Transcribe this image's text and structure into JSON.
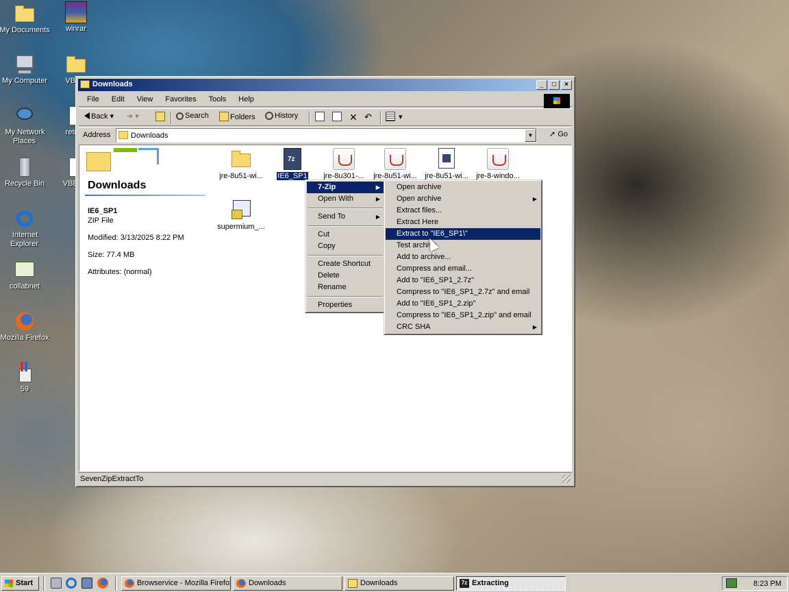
{
  "desktop": {
    "icons": [
      {
        "label": "My Documents",
        "icon": "my-documents-icon"
      },
      {
        "label": "winrar",
        "icon": "winrar-icon"
      },
      {
        "label": "My Computer",
        "icon": "my-computer-icon"
      },
      {
        "label": "VBEM",
        "icon": "folder-icon"
      },
      {
        "label": "My Network Places",
        "icon": "network-places-icon"
      },
      {
        "label": "retrozi",
        "icon": "file-icon"
      },
      {
        "label": "Recycle Bin",
        "icon": "recycle-bin-icon"
      },
      {
        "label": "VBEMP",
        "icon": "file-icon"
      },
      {
        "label": "Internet Explorer",
        "icon": "internet-explorer-icon"
      },
      {
        "label": "collabnet",
        "icon": "collabnet-icon"
      },
      {
        "label": "Mozilla Firefox",
        "icon": "firefox-icon"
      },
      {
        "label": "59",
        "icon": "paint-icon"
      }
    ]
  },
  "window": {
    "title": "Downloads",
    "menu": [
      "File",
      "Edit",
      "View",
      "Favorites",
      "Tools",
      "Help"
    ],
    "toolbar": {
      "back": "Back",
      "search": "Search",
      "folders": "Folders",
      "history": "History"
    },
    "address": {
      "label": "Address",
      "value": "Downloads",
      "go": "Go"
    },
    "left_pane": {
      "title": "Downloads",
      "name": "IE6_SP1",
      "type": "ZIP File",
      "modified": "Modified: 3/13/2025 8:22 PM",
      "size": "Size: 77.4 MB",
      "attributes": "Attributes: (normal)"
    },
    "files": [
      {
        "label": "jre-8u51-wi...",
        "icon": "folder-icon"
      },
      {
        "label": "IE6_SP1",
        "icon": "7zip-archive-icon",
        "selected": true
      },
      {
        "label": "jre-8u301-...",
        "icon": "java-icon"
      },
      {
        "label": "jre-8u51-wi...",
        "icon": "java-icon"
      },
      {
        "label": "jre-8u51-wi...",
        "icon": "7zip-file-icon"
      },
      {
        "label": "jre-8-windo...",
        "icon": "java-icon"
      },
      {
        "label": "supermium_...",
        "icon": "installer-icon"
      }
    ],
    "status": "SevenZipExtractTo"
  },
  "context_menu": {
    "items": [
      "7-Zip",
      "Open With",
      "Send To",
      "Cut",
      "Copy",
      "Create Shortcut",
      "Delete",
      "Rename",
      "Properties"
    ]
  },
  "submenu": {
    "items": [
      "Open archive",
      "Open archive",
      "Extract files...",
      "Extract Here",
      "Extract to \"IE6_SP1\\\"",
      "Test archive",
      "Add to archive...",
      "Compress and email...",
      "Add to \"IE6_SP1_2.7z\"",
      "Compress to \"IE6_SP1_2.7z\" and email",
      "Add to \"IE6_SP1_2.zip\"",
      "Compress to \"IE6_SP1_2.zip\" and email",
      "CRC SHA"
    ],
    "highlighted": "Extract to \"IE6_SP1\\\""
  },
  "taskbar": {
    "start": "Start",
    "tasks": [
      "Browservice - Mozilla Firefox",
      "Downloads",
      "Downloads",
      "Extracting"
    ],
    "clock": "8:23 PM"
  },
  "colors": {
    "highlight": "#0a246a",
    "face": "#d4d0c8"
  }
}
